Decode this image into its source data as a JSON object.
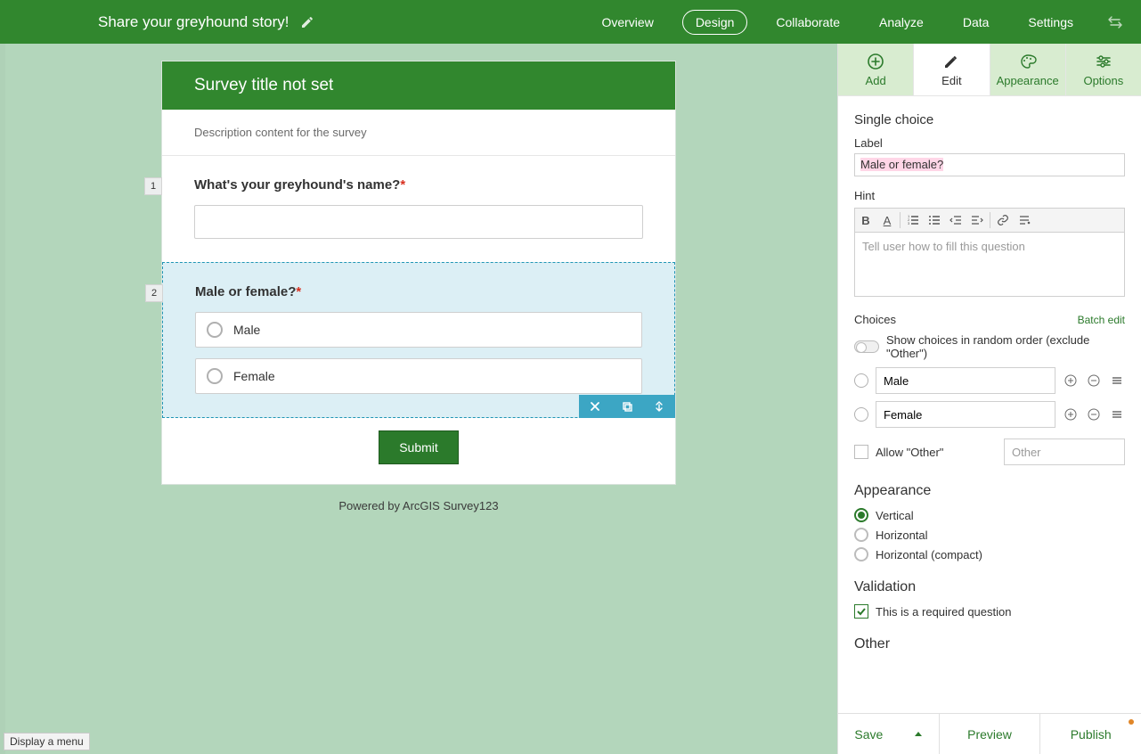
{
  "topbar": {
    "title": "Share your greyhound story!",
    "nav": {
      "overview": "Overview",
      "design": "Design",
      "collaborate": "Collaborate",
      "analyze": "Analyze",
      "data": "Data",
      "settings": "Settings"
    }
  },
  "form": {
    "header": "Survey title not set",
    "description": "Description content for the survey",
    "q1": {
      "num": "1",
      "label": "What's your greyhound's name?"
    },
    "q2": {
      "num": "2",
      "label": "Male or female?",
      "choice1": "Male",
      "choice2": "Female"
    },
    "submit": "Submit",
    "powered": "Powered by ArcGIS Survey123"
  },
  "panel": {
    "tabs": {
      "add": "Add",
      "edit": "Edit",
      "appearance": "Appearance",
      "options": "Options"
    },
    "qtype": "Single choice",
    "labelTitle": "Label",
    "labelValue": "Male or female?",
    "hintTitle": "Hint",
    "hintPlaceholder": "Tell user how to fill this question",
    "choicesTitle": "Choices",
    "batchEdit": "Batch edit",
    "randomOrder": "Show choices in random order (exclude \"Other\")",
    "choice1": "Male",
    "choice2": "Female",
    "allowOther": "Allow \"Other\"",
    "otherPlaceholder": "Other",
    "appearanceTitle": "Appearance",
    "vertical": "Vertical",
    "horizontal": "Horizontal",
    "horizontalCompact": "Horizontal (compact)",
    "validationTitle": "Validation",
    "requiredText": "This is a required question",
    "otherTitle": "Other"
  },
  "footer": {
    "save": "Save",
    "preview": "Preview",
    "publish": "Publish"
  },
  "status": "Display a menu"
}
